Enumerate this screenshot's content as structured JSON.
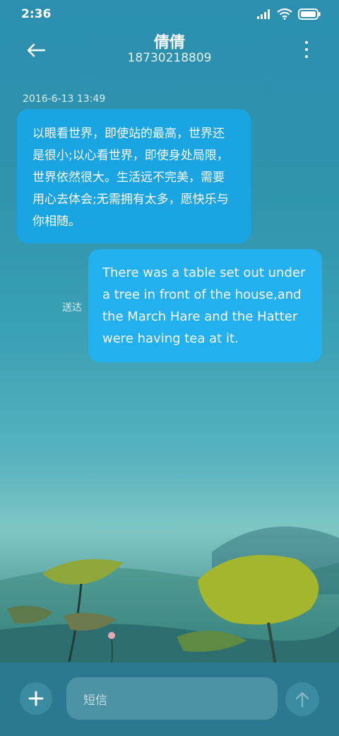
{
  "status_bar": {
    "time": "2:36"
  },
  "header": {
    "name": "倩倩",
    "phone": "18730218809"
  },
  "conversation": {
    "timestamp": "2016-6-13 13:49",
    "incoming_message": "以眼看世界，即使站的最高，世界还是很小;以心看世界，即使身处局限，世界依然很大。生活远不完美，需要用心去体会;无需拥有太多，愿快乐与你相随。",
    "outgoing_message": "There was a table set out under a tree in front of the house,and the March Hare and the Hatter were having tea at it.",
    "outgoing_status": "送达"
  },
  "composer": {
    "placeholder": "短信"
  },
  "colors": {
    "incoming_bubble": "#1ba4e2",
    "outgoing_bubble": "#22b0ee"
  },
  "icons": [
    "signal-icon",
    "wifi-icon",
    "battery-icon",
    "back-arrow-icon",
    "more-menu-icon",
    "plus-icon",
    "send-arrow-icon"
  ]
}
